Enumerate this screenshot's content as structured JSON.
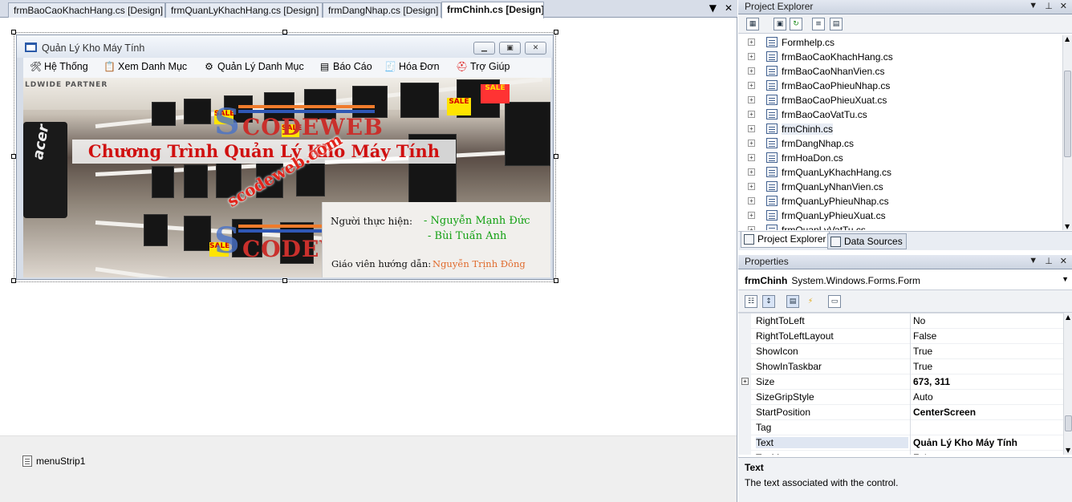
{
  "doc_tabs": [
    {
      "label": "frmBaoCaoKhachHang.cs [Design]",
      "active": false
    },
    {
      "label": "frmQuanLyKhachHang.cs [Design]",
      "active": false
    },
    {
      "label": "frmDangNhap.cs [Design]",
      "active": false
    },
    {
      "label": "frmChinh.cs [Design]",
      "active": true
    }
  ],
  "tab_controls": {
    "dropdown": "▼",
    "close": "✕"
  },
  "form": {
    "title": "Quản Lý Kho Máy Tính",
    "menu": [
      {
        "label": "Hệ Thống",
        "icon": "tools-icon"
      },
      {
        "label": "Xem Danh Mục",
        "icon": "view-list-icon"
      },
      {
        "label": "Quản Lý Danh Mục",
        "icon": "manage-icon"
      },
      {
        "label": "Báo Cáo",
        "icon": "report-icon"
      },
      {
        "label": "Hóa Đơn",
        "icon": "invoice-icon"
      },
      {
        "label": "Trợ Giúp",
        "icon": "help-icon"
      }
    ]
  },
  "banner": {
    "top_text": "LDWIDE PARTNER",
    "title": "Chương Trình Quản Lý Kho Máy Tính",
    "brand": "acer",
    "logo_text": "CODEWEB",
    "logo_s": "S",
    "watermark": "scodeweb.com",
    "signs": [
      "SALE",
      "SALE",
      "SALE",
      "SALE",
      "SALE"
    ],
    "performer_label": "Người thực hiện:",
    "performers": [
      "- Nguyễn Mạnh Đức",
      "- Bùi Tuấn Anh"
    ],
    "teacher_label": "Giáo viên hướng dẫn:",
    "teacher": "Nguyễn Trịnh Đông"
  },
  "tray": {
    "item": "menuStrip1"
  },
  "project_explorer": {
    "title": "Project Explorer",
    "files": [
      "Formhelp.cs",
      "frmBaoCaoKhachHang.cs",
      "frmBaoCaoNhanVien.cs",
      "frmBaoCaoPhieuNhap.cs",
      "frmBaoCaoPhieuXuat.cs",
      "frmBaoCaoVatTu.cs",
      "frmChinh.cs",
      "frmDangNhap.cs",
      "frmHoaDon.cs",
      "frmQuanLyKhachHang.cs",
      "frmQuanLyNhanVien.cs",
      "frmQuanLyPhieuNhap.cs",
      "frmQuanLyPhieuXuat.cs",
      "frmQuanLyVatTu.cs"
    ],
    "selected": "frmChinh.cs",
    "tabs": [
      "Project Explorer",
      "Data Sources"
    ]
  },
  "properties": {
    "title": "Properties",
    "object_name": "frmChinh",
    "object_type": "System.Windows.Forms.Form",
    "rows": [
      {
        "name": "RightToLeft",
        "value": "No",
        "bold": false,
        "expandable": false
      },
      {
        "name": "RightToLeftLayout",
        "value": "False",
        "bold": false,
        "expandable": false
      },
      {
        "name": "ShowIcon",
        "value": "True",
        "bold": false,
        "expandable": false
      },
      {
        "name": "ShowInTaskbar",
        "value": "True",
        "bold": false,
        "expandable": false
      },
      {
        "name": "Size",
        "value": "673, 311",
        "bold": true,
        "expandable": true
      },
      {
        "name": "SizeGripStyle",
        "value": "Auto",
        "bold": false,
        "expandable": false
      },
      {
        "name": "StartPosition",
        "value": "CenterScreen",
        "bold": true,
        "expandable": false
      },
      {
        "name": "Tag",
        "value": "",
        "bold": false,
        "expandable": false
      },
      {
        "name": "Text",
        "value": "Quản Lý Kho Máy Tính",
        "bold": true,
        "expandable": false
      },
      {
        "name": "TopMost",
        "value": "False",
        "bold": false,
        "expandable": false
      }
    ],
    "selected": "Text",
    "desc_title": "Text",
    "desc_body": "The text associated with the control."
  }
}
